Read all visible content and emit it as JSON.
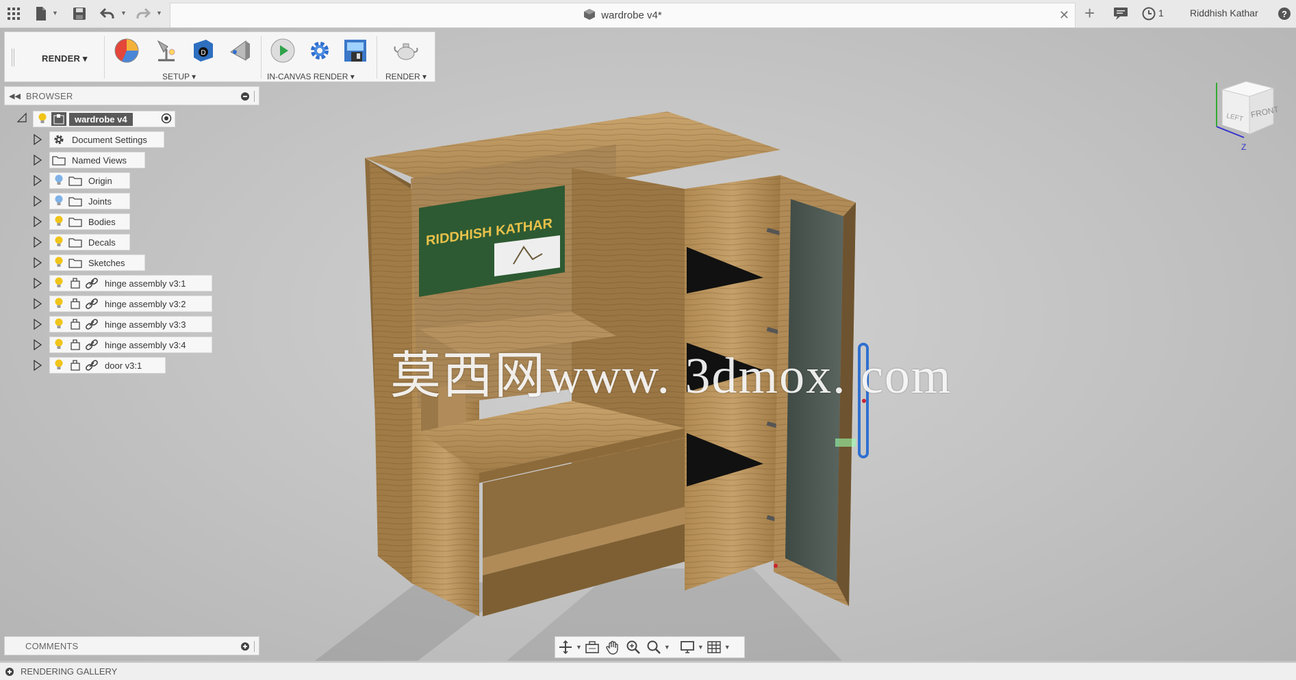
{
  "window": {
    "document_title": "wardrobe v4*",
    "job_count": "1",
    "user_name": "Riddhish Kathar"
  },
  "toolbar": {
    "workspace_label": "RENDER",
    "groups": [
      {
        "label": "SETUP"
      },
      {
        "label": "IN-CANVAS RENDER"
      },
      {
        "label": "RENDER"
      }
    ],
    "tools": [
      "appearance-icon",
      "scene-settings-icon",
      "decal-icon",
      "texture-map-icon",
      "in-canvas-render-icon",
      "render-settings-icon",
      "capture-image-icon",
      "render-teapot-icon"
    ]
  },
  "browser": {
    "title": "BROWSER",
    "root": {
      "label": "wardrobe v4"
    },
    "items": [
      {
        "label": "Document Settings",
        "icon": "gear-icon"
      },
      {
        "label": "Named Views",
        "icon": "folder-icon"
      },
      {
        "label": "Origin",
        "icon": "folder-icon",
        "visibility": "lightbulb-off"
      },
      {
        "label": "Joints",
        "icon": "folder-icon",
        "visibility": "lightbulb-off"
      },
      {
        "label": "Bodies",
        "icon": "folder-icon",
        "visibility": "lightbulb-on"
      },
      {
        "label": "Decals",
        "icon": "folder-icon",
        "visibility": "lightbulb-on"
      },
      {
        "label": "Sketches",
        "icon": "folder-icon",
        "visibility": "lightbulb-on"
      },
      {
        "label": "hinge assembly v3:1",
        "icon": "component-link-icon",
        "visibility": "lightbulb-on"
      },
      {
        "label": "hinge assembly v3:2",
        "icon": "component-link-icon",
        "visibility": "lightbulb-on"
      },
      {
        "label": "hinge assembly v3:3",
        "icon": "component-link-icon",
        "visibility": "lightbulb-on"
      },
      {
        "label": "hinge assembly v3:4",
        "icon": "component-link-icon",
        "visibility": "lightbulb-on"
      },
      {
        "label": "door v3:1",
        "icon": "component-link-icon",
        "visibility": "lightbulb-on"
      }
    ]
  },
  "comments": {
    "title": "COMMENTS"
  },
  "statusbar": {
    "label": "RENDERING GALLERY"
  },
  "viewport": {
    "watermark": "莫西网www. 3dmox. com",
    "decal_text": "RIDDHISH KATHAR",
    "viewcube_face": "FRONT",
    "viewcube_left": "LEFT",
    "axis_z": "Z"
  },
  "colors": {
    "accent_blue": "#2f6fd0",
    "wood_light": "#b8955e",
    "wood_dark": "#8a6a3a",
    "board_green": "#2d5a33",
    "lightbulb_on": "#f0c419",
    "lightbulb_off": "#7fb2e8"
  }
}
